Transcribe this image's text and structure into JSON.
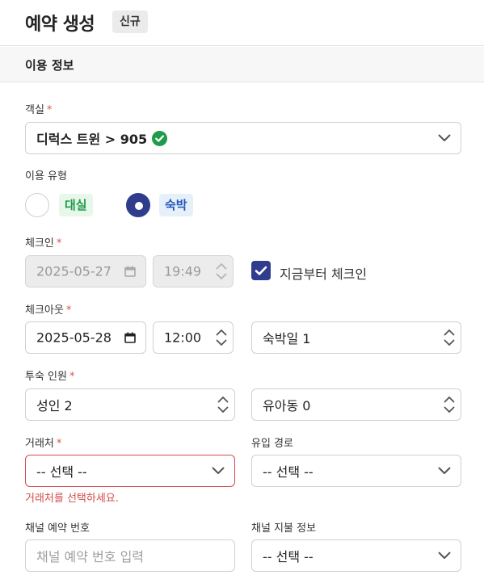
{
  "header": {
    "title": "예약 생성",
    "badge": "신규"
  },
  "section": {
    "title": "이용 정보"
  },
  "room": {
    "label": "객실",
    "required_mark": "*",
    "value": "디럭스 트윈 > 905"
  },
  "usage_type": {
    "label": "이용 유형",
    "options": [
      {
        "label": "대실",
        "selected": false,
        "color": "#1e9c4b",
        "bg": "#e7f7ea"
      },
      {
        "label": "숙박",
        "selected": true,
        "color": "#2456b8",
        "bg": "#e6f0fb"
      }
    ]
  },
  "checkin": {
    "label": "체크인",
    "required_mark": "*",
    "date": "2025-05-27",
    "time": "19:49",
    "now_label": "지금부터 체크인",
    "now_checked": true
  },
  "checkout": {
    "label": "체크아웃",
    "required_mark": "*",
    "date": "2025-05-28",
    "time": "12:00",
    "nights": "숙박일 1"
  },
  "guests": {
    "label": "투숙 인원",
    "required_mark": "*",
    "adults": "성인 2",
    "children": "유아동 0"
  },
  "partner": {
    "label": "거래처",
    "required_mark": "*",
    "value": "-- 선택 --",
    "error": "거래처를 선택하세요."
  },
  "inflow": {
    "label": "유입 경로",
    "value": "-- 선택 --"
  },
  "channel_no": {
    "label": "채널 예약 번호",
    "placeholder": "채널 예약 번호 입력"
  },
  "channel_pay": {
    "label": "채널 지불 정보",
    "value": "-- 선택 --"
  },
  "colors": {
    "primary": "#2f3d8c",
    "error": "#d24a4a",
    "verified": "#1e9c4b"
  }
}
